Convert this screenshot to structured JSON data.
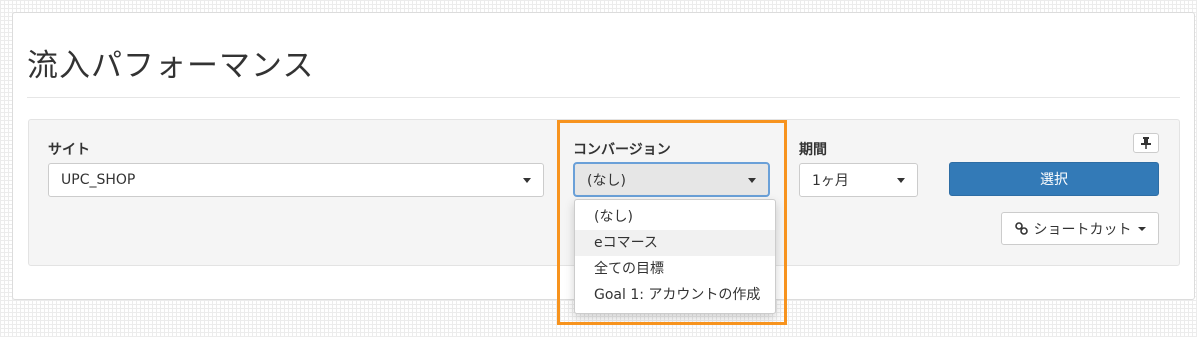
{
  "page": {
    "title": "流入パフォーマンス"
  },
  "filters": {
    "site": {
      "label": "サイト",
      "value": "UPC_SHOP"
    },
    "conversion": {
      "label": "コンバージョン",
      "value": "(なし)",
      "options": [
        "(なし)",
        "eコマース",
        "全ての目標",
        "Goal 1: アカウントの作成"
      ],
      "hovered_option": "eコマース"
    },
    "period": {
      "label": "期間",
      "value": "1ヶ月"
    }
  },
  "actions": {
    "select_label": "選択",
    "shortcut_label": "ショートカット",
    "pin_icon": "pin-icon",
    "link_icon": "link-icon"
  },
  "colors": {
    "primary": "#337ab7",
    "highlight": "#f7931e"
  }
}
